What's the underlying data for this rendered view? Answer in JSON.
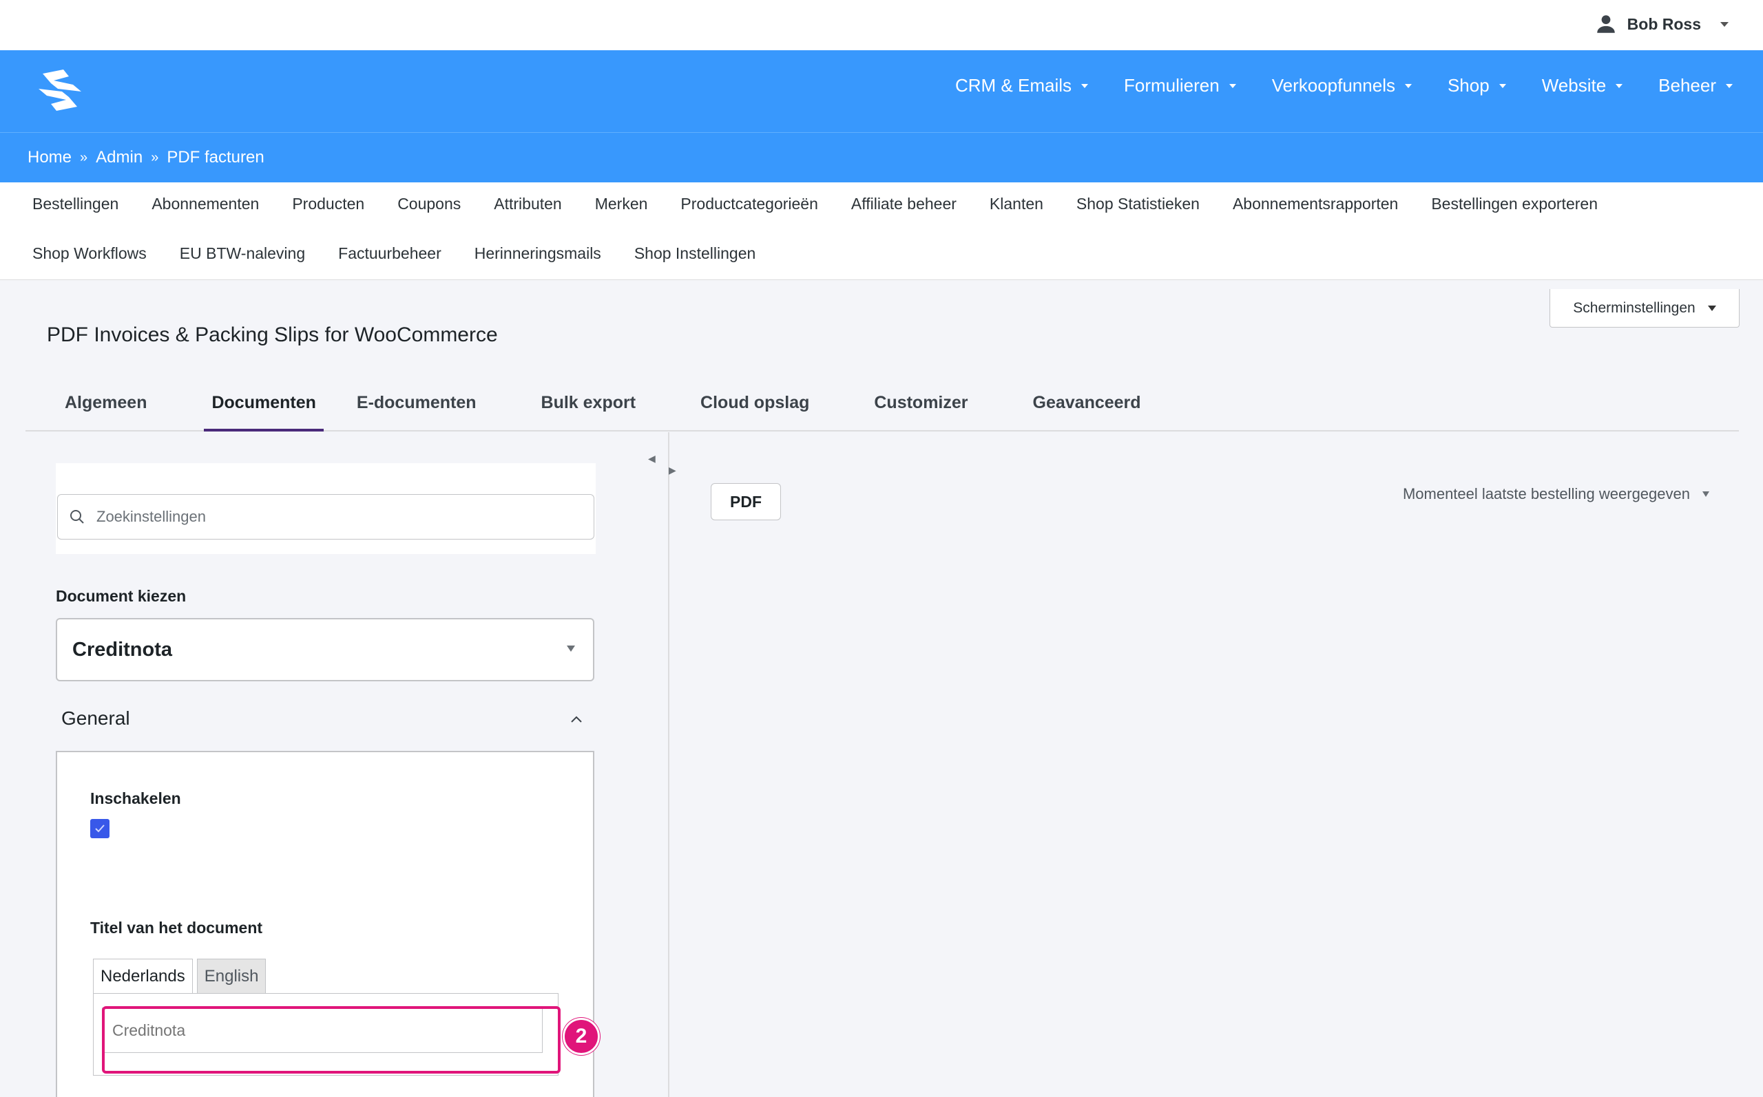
{
  "user": {
    "name": "Bob Ross"
  },
  "header": {
    "nav": [
      "CRM & Emails",
      "Formulieren",
      "Verkoopfunnels",
      "Shop",
      "Website",
      "Beheer"
    ]
  },
  "breadcrumb": {
    "items": [
      "Home",
      "Admin",
      "PDF facturen"
    ],
    "separator": "»"
  },
  "subnav": {
    "row1": [
      "Bestellingen",
      "Abonnementen",
      "Producten",
      "Coupons",
      "Attributen",
      "Merken",
      "Productcategorieën",
      "Affiliate beheer",
      "Klanten",
      "Shop Statistieken",
      "Abonnementsrapporten",
      "Bestellingen exporteren"
    ],
    "row2": [
      "Shop Workflows",
      "EU BTW-naleving",
      "Factuurbeheer",
      "Herinneringsmails",
      "Shop Instellingen"
    ]
  },
  "screen_options": {
    "label": "Scherminstellingen"
  },
  "page": {
    "title": "PDF Invoices & Packing Slips for WooCommerce"
  },
  "tabs": [
    "Algemeen",
    "Documenten",
    "E-documenten",
    "Bulk export",
    "Cloud opslag",
    "Customizer",
    "Geavanceerd"
  ],
  "active_tab": "Documenten",
  "search": {
    "placeholder": "Zoekinstellingen"
  },
  "document": {
    "label": "Document kiezen",
    "selected": "Creditnota"
  },
  "general": {
    "heading": "General",
    "enable_label": "Inschakelen",
    "enabled": true,
    "title_label": "Titel van het document",
    "languages": [
      "Nederlands",
      "English"
    ],
    "title_placeholder": "Creditnota"
  },
  "annotation": {
    "step": "2",
    "color": "#e0157a"
  },
  "preview": {
    "pdf_button": "PDF",
    "order_select": "Momenteel laatste bestelling weergegeven"
  },
  "colors": {
    "brand_blue": "#3898fd",
    "accent_purple": "#4a2a7a",
    "checkbox_blue": "#3858e9"
  }
}
